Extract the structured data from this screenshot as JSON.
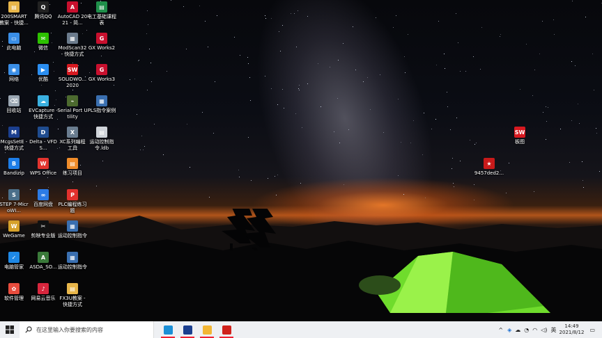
{
  "desktop": {
    "icons": [
      {
        "label": "200SMART 教案 - 快捷...",
        "icon": "shortcut-file-icon",
        "color": "#e8b64a",
        "glyph": "▤"
      },
      {
        "label": "此电脑",
        "icon": "computer-icon",
        "color": "#3a8ee6",
        "glyph": "▭"
      },
      {
        "label": "网络",
        "icon": "network-icon",
        "color": "#3a8ee6",
        "glyph": "◉"
      },
      {
        "label": "回收站",
        "icon": "recycle-bin-icon",
        "color": "#9aa6b2",
        "glyph": "⌫"
      },
      {
        "label": "McgsSetE - 快捷方式",
        "icon": "mcgs-icon",
        "color": "#1b3f8f",
        "glyph": "M"
      },
      {
        "label": "Bandizip",
        "icon": "bandizip-icon",
        "color": "#1d7de8",
        "glyph": "B"
      },
      {
        "label": "STEP 7-MicroWI...",
        "icon": "step7-icon",
        "color": "#4b6f8a",
        "glyph": "S"
      },
      {
        "label": "WeGame",
        "icon": "wegame-icon",
        "color": "#d6a12a",
        "glyph": "W"
      },
      {
        "label": "电脑管家",
        "icon": "pc-manager-icon",
        "color": "#1e88e5",
        "glyph": "✓"
      },
      {
        "label": "软件管理",
        "icon": "software-manager-icon",
        "color": "#e84c3d",
        "glyph": "✿"
      },
      {
        "label": "腾讯QQ",
        "icon": "qq-icon",
        "color": "#222222",
        "glyph": "Q"
      },
      {
        "label": "微信",
        "icon": "wechat-icon",
        "color": "#2dc100",
        "glyph": "✉"
      },
      {
        "label": "优酷",
        "icon": "youku-icon",
        "color": "#2b8ef0",
        "glyph": "▶"
      },
      {
        "label": "EVCapture - 快捷方式",
        "icon": "evcapture-icon",
        "color": "#3ab0e0",
        "glyph": "☁"
      },
      {
        "label": "Delta - VFDS...",
        "icon": "delta-icon",
        "color": "#1f4c8f",
        "glyph": "D"
      },
      {
        "label": "WPS Office",
        "icon": "wps-icon",
        "color": "#e3342f",
        "glyph": "W"
      },
      {
        "label": "百度网盘",
        "icon": "baidu-netdisk-icon",
        "color": "#2c7be5",
        "glyph": "∞"
      },
      {
        "label": "剪映专业版",
        "icon": "capcut-icon",
        "color": "#111111",
        "glyph": "✂"
      },
      {
        "label": "ASDA_SO...",
        "icon": "asda-icon",
        "color": "#3a7a3a",
        "glyph": "A"
      },
      {
        "label": "网易云音乐",
        "icon": "netease-music-icon",
        "color": "#d7263d",
        "glyph": "♪"
      },
      {
        "label": "AutoCAD 2021 - 简...",
        "icon": "autocad-icon",
        "color": "#c8102e",
        "glyph": "A"
      },
      {
        "label": "ModScan32 - 快捷方式",
        "icon": "modscan-icon",
        "color": "#6b7b8c",
        "glyph": "▦"
      },
      {
        "label": "SOLIDWO... 2020",
        "icon": "solidworks-icon",
        "color": "#d71920",
        "glyph": "SW"
      },
      {
        "label": "Serial Port Utility",
        "icon": "serial-port-icon",
        "color": "#4c6a2f",
        "glyph": "⌁"
      },
      {
        "label": "XC系列编程工具",
        "icon": "xc-programming-icon",
        "color": "#6a7d90",
        "glyph": "X"
      },
      {
        "label": "练习项目",
        "icon": "project-file-icon",
        "color": "#f08c2a",
        "glyph": "▤"
      },
      {
        "label": "PLC编程练习题",
        "icon": "pdf-icon",
        "color": "#e2312d",
        "glyph": "P"
      },
      {
        "label": "运动控制指令",
        "icon": "motion-control-icon",
        "color": "#3a6fb0",
        "glyph": "▦"
      },
      {
        "label": "运动控制指令",
        "icon": "motion-control-icon-2",
        "color": "#3a6fb0",
        "glyph": "▦"
      },
      {
        "label": "FX3U教案 - 快捷方式",
        "icon": "fx3u-doc-icon",
        "color": "#e8b64a",
        "glyph": "▤"
      },
      {
        "label": "电工基础课程表",
        "icon": "document-icon",
        "color": "#1f8f4a",
        "glyph": "▤"
      },
      {
        "label": "GX Works2",
        "icon": "gx-works2-icon",
        "color": "#c8102e",
        "glyph": "G"
      },
      {
        "label": "GX Works3",
        "icon": "gx-works3-icon",
        "color": "#c8102e",
        "glyph": "G"
      },
      {
        "label": "PLS指令案例",
        "icon": "pls-icon",
        "color": "#3a6fb0",
        "glyph": "▦"
      },
      {
        "label": "运动控制指令.ldb",
        "icon": "ldb-file-icon",
        "color": "#d0d4da",
        "glyph": "▤"
      },
      {
        "label": "板图",
        "icon": "solidworks-file-icon",
        "color": "#d71920",
        "glyph": "SW"
      },
      {
        "label": "9457ded2...",
        "icon": "image-file-icon",
        "color": "#c81a1a",
        "glyph": "★"
      }
    ]
  },
  "taskbar": {
    "search_placeholder": "在这里输入你要搜索的内容",
    "pinned": [
      {
        "name": "edge-browser-icon",
        "color": "#1b8fd6"
      },
      {
        "name": "mcgs-taskbar-icon",
        "color": "#1b3f8f"
      },
      {
        "name": "file-explorer-icon",
        "color": "#f2b634"
      },
      {
        "name": "pdf-reader-icon",
        "color": "#d0221c"
      }
    ],
    "tray": {
      "ime": "英",
      "time": "14:49",
      "date": "2021/8/12"
    }
  }
}
